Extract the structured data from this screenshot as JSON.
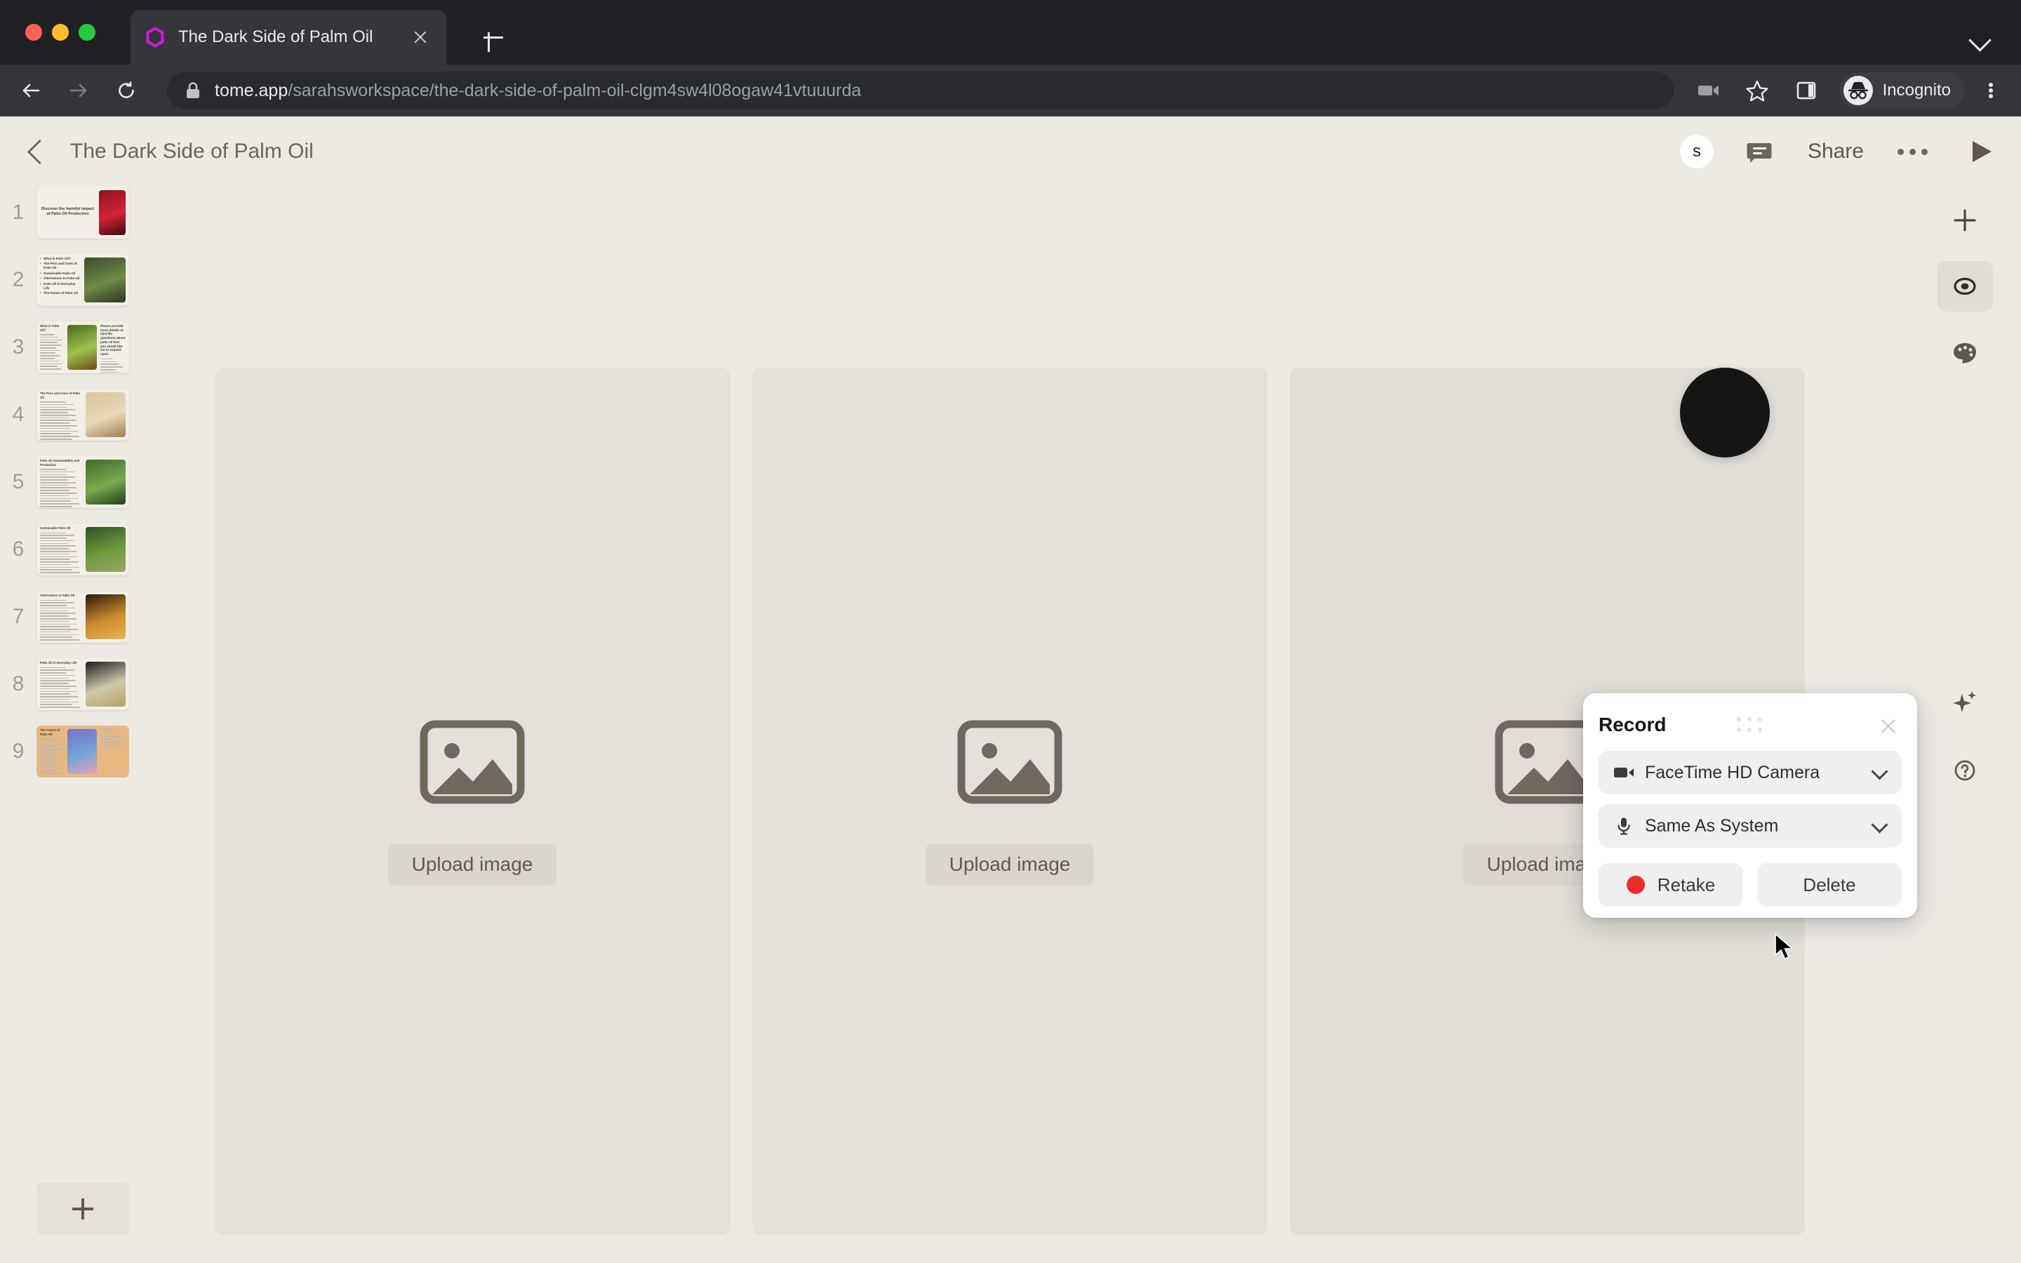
{
  "browser": {
    "traffic_lights": [
      "close",
      "minimize",
      "maximize"
    ],
    "tab": {
      "title": "The Dark Side of Palm Oil",
      "favicon": "tome-hexagon-icon",
      "close_icon": "close-icon"
    },
    "new_tab_label": "+",
    "tabstrip_chevron": "chevron-down-icon",
    "nav": {
      "back_icon": "arrow-left-icon",
      "forward_icon": "arrow-right-icon",
      "reload_icon": "reload-icon"
    },
    "omnibox": {
      "lock_icon": "lock-icon",
      "url_host": "tome.app",
      "url_path": "/sarahsworkspace/the-dark-side-of-palm-oil-clgm4sw4l08ogaw41vtuuurda"
    },
    "toolbar_icons": [
      "video-camera-icon",
      "star-icon",
      "side-panel-icon"
    ],
    "profile": {
      "icon": "incognito-icon",
      "label": "Incognito"
    },
    "menu_icon": "kebab-menu-icon"
  },
  "app": {
    "header": {
      "back_icon": "chevron-left-icon",
      "title": "The Dark Side of Palm Oil",
      "avatar_initial": "s",
      "comment_icon": "comment-icon",
      "share_label": "Share",
      "more_icon": "more-dots-icon",
      "play_icon": "play-icon"
    },
    "filmstrip": {
      "add_slide_icon": "plus-icon",
      "slides": [
        {
          "number": "1",
          "title": "Discover the harmful impact of Palm Oil Production",
          "current": false,
          "layout": "title-image",
          "image_colors": [
            "#8d1220",
            "#d62235",
            "#3b0a10"
          ]
        },
        {
          "number": "2",
          "title": "",
          "current": false,
          "layout": "bullets-image",
          "bullets": [
            "What is Palm Oil?",
            "The Pros and Cons of Palm Oil",
            "Sustainable Palm Oil",
            "Alternatives to Palm Oil",
            "Palm Oil in Everyday Life",
            "The Future of Palm Oil"
          ],
          "image_colors": [
            "#3e4a2c",
            "#6f8a46",
            "#2c3520"
          ]
        },
        {
          "number": "3",
          "title": "What is Palm Oil?",
          "current": false,
          "layout": "text-image-text",
          "side_text": "Please provide more details or specific questions about palm oil that you would like me to expand upon.",
          "image_colors": [
            "#4b6b22",
            "#9ec24a",
            "#6d4a1c"
          ]
        },
        {
          "number": "4",
          "title": "The Pros and Cons of Palm Oil",
          "current": false,
          "layout": "text-image",
          "image_colors": [
            "#d8c39b",
            "#e8d9b8",
            "#9c7f55"
          ]
        },
        {
          "number": "5",
          "title": "Palm Oil Sustainability and Production",
          "current": false,
          "layout": "text-image",
          "image_colors": [
            "#3f6b2c",
            "#79a94e",
            "#22401c"
          ]
        },
        {
          "number": "6",
          "title": "Sustainable Palm Oil",
          "current": false,
          "layout": "text-image",
          "image_colors": [
            "#2f5122",
            "#6f9a3e",
            "#9aa86c"
          ]
        },
        {
          "number": "7",
          "title": "Alternatives to Palm Oil",
          "current": false,
          "layout": "text-image",
          "image_colors": [
            "#2a1a0c",
            "#c98a2c",
            "#f0b451"
          ]
        },
        {
          "number": "8",
          "title": "Palm Oil in Everyday Life",
          "current": false,
          "layout": "text-image",
          "image_colors": [
            "#1d1d1d",
            "#cfc9ad",
            "#b4a15e"
          ]
        },
        {
          "number": "9",
          "title": "The Future of Palm Oil",
          "current": true,
          "layout": "text-image-text",
          "image_colors": [
            "#7a6fd0",
            "#6fa6d8",
            "#e8a0b8"
          ]
        }
      ]
    },
    "canvas": {
      "panels": [
        {
          "icon": "image-placeholder-icon",
          "upload_label": "Upload image",
          "selected": false
        },
        {
          "icon": "image-placeholder-icon",
          "upload_label": "Upload image",
          "selected": false
        },
        {
          "icon": "image-placeholder-icon",
          "upload_label": "Upload image",
          "selected": true
        }
      ],
      "video_bubble": {
        "color": "#151515"
      }
    },
    "rail": [
      {
        "icon": "plus-icon",
        "active": false
      },
      {
        "icon": "record-target-icon",
        "active": true
      },
      {
        "icon": "palette-icon",
        "active": false
      },
      {
        "icon": "sparkle-icon",
        "active": false
      },
      {
        "icon": "help-circle-icon",
        "active": false
      }
    ],
    "record_dialog": {
      "title": "Record",
      "grip_icon": "drag-handle-icon",
      "close_icon": "close-icon",
      "camera": {
        "icon": "video-camera-icon",
        "value": "FaceTime HD Camera",
        "chevron": "chevron-down-icon"
      },
      "audio": {
        "icon": "microphone-icon",
        "value": "Same As System",
        "chevron": "chevron-down-icon"
      },
      "retake_label": "Retake",
      "retake_dot_color": "#ee2b2b",
      "delete_label": "Delete"
    }
  },
  "colors": {
    "app_bg": "#EDEAE4",
    "panel_bg": "#E4E0DA",
    "chrome_bg": "#202124",
    "toolbar_bg": "#35363a",
    "accent_favicon": "#d916e8"
  }
}
